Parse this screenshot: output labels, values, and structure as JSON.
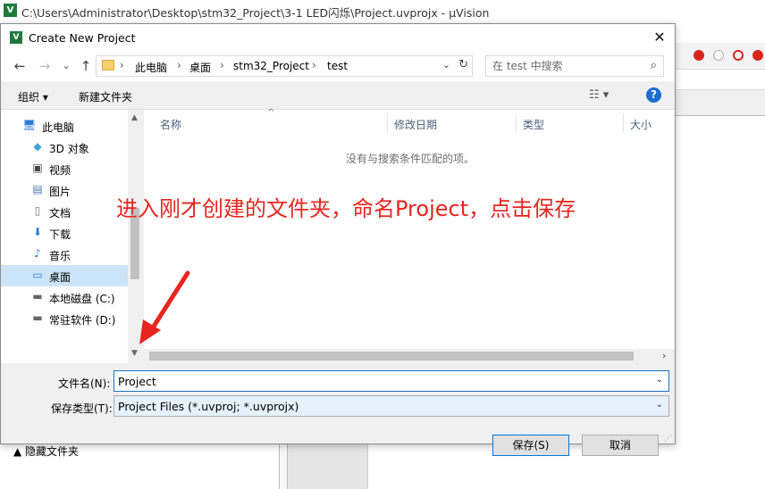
{
  "app": {
    "title": "C:\\Users\\Administrator\\Desktop\\stm32_Project\\3-1 LED闪烁\\Project.uvprojx - µVision",
    "logo": "V"
  },
  "dialog": {
    "title": "Create New Project",
    "close_icon": "✕",
    "nav": {
      "back_icon": "←",
      "forward_icon": "→",
      "recent_icon": "⌄",
      "up_icon": "↑",
      "breadcrumb": [
        "此电脑",
        "桌面",
        "stm32_Project",
        "test"
      ],
      "separator": "›",
      "dropdown_icon": "⌄",
      "refresh_icon": "↻",
      "search_placeholder": "在 test 中搜索",
      "search_icon": "⌕"
    },
    "commands": {
      "organize": "组织 ▾",
      "new_folder": "新建文件夹",
      "view_icon": "☷ ▾",
      "help_icon": "?"
    },
    "nav_pane": {
      "items": [
        {
          "icon": "🖥",
          "label": "此电脑",
          "selected": false
        },
        {
          "icon": "◆",
          "label": "3D 对象",
          "selected": false
        },
        {
          "icon": "▣",
          "label": "视频",
          "selected": false
        },
        {
          "icon": "▤",
          "label": "图片",
          "selected": false
        },
        {
          "icon": "▯",
          "label": "文档",
          "selected": false
        },
        {
          "icon": "⬇",
          "label": "下载",
          "selected": false
        },
        {
          "icon": "♪",
          "label": "音乐",
          "selected": false
        },
        {
          "icon": "▭",
          "label": "桌面",
          "selected": true
        },
        {
          "icon": "▬",
          "label": "本地磁盘 (C:)",
          "selected": false
        },
        {
          "icon": "▬",
          "label": "常驻软件 (D:)",
          "selected": false
        }
      ],
      "scroll_up": "▲",
      "scroll_down": "▼"
    },
    "file_list": {
      "columns": [
        "名称",
        "修改日期",
        "类型",
        "大小"
      ],
      "sort_arrow": "^",
      "empty_message": "没有与搜索条件匹配的项。",
      "scroll_right": "›"
    },
    "form": {
      "filename_label": "文件名(N):",
      "filename_value": "Project",
      "filetype_label": "保存类型(T):",
      "filetype_value": "Project Files (*.uvproj; *.uvprojx)",
      "chevron": "⌄",
      "hide_folders": "▲ 隐藏文件夹",
      "save_button": "保存(S)",
      "cancel_button": "取消"
    }
  },
  "annotation": {
    "text": "进入刚才创建的文件夹，命名Project，点击保存",
    "color": "#e8251f"
  },
  "colors": {
    "selection": "#cce4f7",
    "accent": "#0078d7"
  }
}
